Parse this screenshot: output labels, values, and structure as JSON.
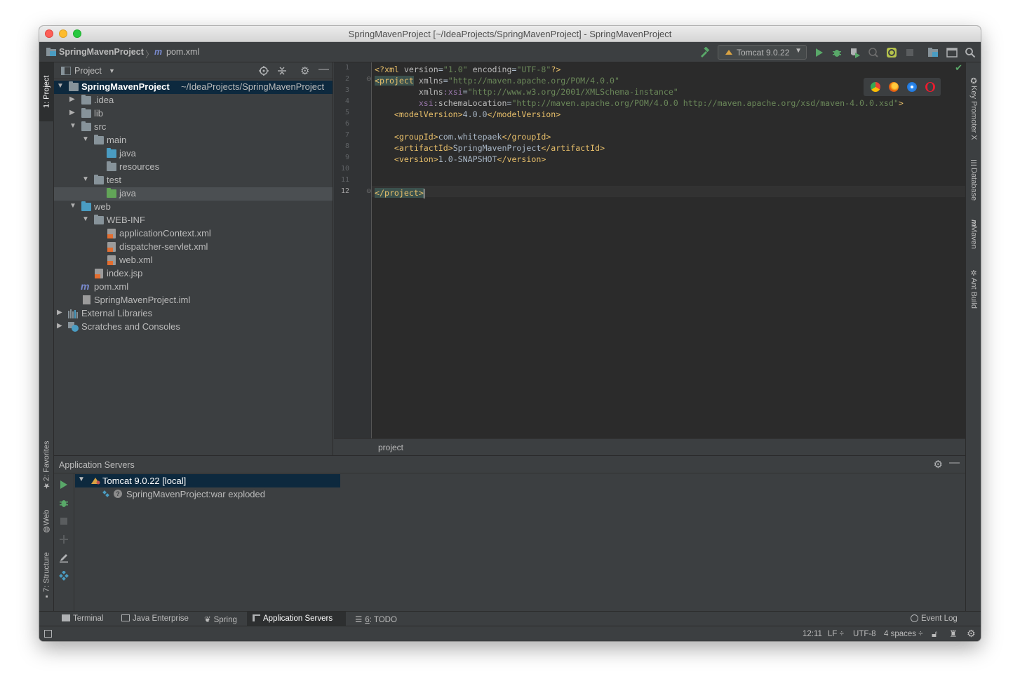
{
  "window": {
    "title": "SpringMavenProject [~/IdeaProjects/SpringMavenProject] - SpringMavenProject"
  },
  "navbar": {
    "project_crumb": "SpringMavenProject",
    "file_crumb": "pom.xml",
    "run_config": "Tomcat 9.0.22"
  },
  "left_stripe": {
    "project_tab": "1: Project",
    "favorites_tab": "2: Favorites",
    "web_tab": "Web",
    "structure_tab": "7: Structure"
  },
  "right_stripe": {
    "key_promoter": "Key Promoter X",
    "database": "Database",
    "maven": "Maven",
    "ant_build": "Ant Build"
  },
  "project_panel": {
    "title": "Project",
    "root_name": "SpringMavenProject",
    "root_path": "~/IdeaProjects/SpringMavenProject",
    "items": [
      {
        "label": ".idea"
      },
      {
        "label": "lib"
      },
      {
        "label": "src"
      },
      {
        "label": "main"
      },
      {
        "label": "java"
      },
      {
        "label": "resources"
      },
      {
        "label": "test"
      },
      {
        "label": "java"
      },
      {
        "label": "web"
      },
      {
        "label": "WEB-INF"
      },
      {
        "label": "applicationContext.xml"
      },
      {
        "label": "dispatcher-servlet.xml"
      },
      {
        "label": "web.xml"
      },
      {
        "label": "index.jsp"
      },
      {
        "label": "pom.xml"
      },
      {
        "label": "SpringMavenProject.iml"
      },
      {
        "label": "External Libraries"
      },
      {
        "label": "Scratches and Consoles"
      }
    ]
  },
  "editor": {
    "line_numbers": [
      "1",
      "2",
      "3",
      "4",
      "5",
      "6",
      "7",
      "8",
      "9",
      "10",
      "11",
      "12"
    ],
    "lines": {
      "l1_a": "<?xml ",
      "l1_b": "version",
      "l1_c": "=",
      "l1_d": "\"1.0\"",
      "l1_e": " encoding",
      "l1_f": "=",
      "l1_g": "\"UTF-8\"",
      "l1_h": "?>",
      "l2_a": "<project",
      "l2_b": " xmlns",
      "l2_c": "=",
      "l2_d": "\"http://maven.apache.org/POM/4.0.0\"",
      "l3_a": "         xmlns",
      "l3_b": ":xsi",
      "l3_c": "=",
      "l3_d": "\"http://www.w3.org/2001/XMLSchema-instance\"",
      "l4_a": "         xsi",
      "l4_b": ":schemaLocation",
      "l4_c": "=",
      "l4_d": "\"http://maven.apache.org/POM/4.0.0 http://maven.apache.org/xsd/maven-4.0.0.xsd\"",
      "l4_e": ">",
      "l5_a": "    <modelVersion>",
      "l5_b": "4.0.0",
      "l5_c": "</modelVersion>",
      "l7_a": "    <groupId>",
      "l7_b": "com.whitepaek",
      "l7_c": "</groupId>",
      "l8_a": "    <artifactId>",
      "l8_b": "SpringMavenProject",
      "l8_c": "</artifactId>",
      "l9_a": "    <version>",
      "l9_b": "1.0-SNAPSHOT",
      "l9_c": "</version>",
      "l12_a": "</project>"
    },
    "breadcrumb": "project"
  },
  "servers_panel": {
    "title": "Application Servers",
    "server": "Tomcat 9.0.22 [local]",
    "artifact": "SpringMavenProject:war exploded"
  },
  "bottom_tabs": {
    "terminal": "Terminal",
    "java_enterprise": "Java Enterprise",
    "spring": "Spring",
    "application_servers": "Application Servers",
    "todo_num": "6",
    "todo_rest": ": TODO",
    "event_log": "Event Log"
  },
  "status": {
    "position": "12:11",
    "line_sep": "LF ÷",
    "encoding": "UTF-8",
    "indent": "4 spaces ÷"
  },
  "colors": {
    "accent_selection": "#0d293e",
    "run_green": "#59a869",
    "xml_tag": "#e8bf6a",
    "xml_value": "#6a8759"
  }
}
